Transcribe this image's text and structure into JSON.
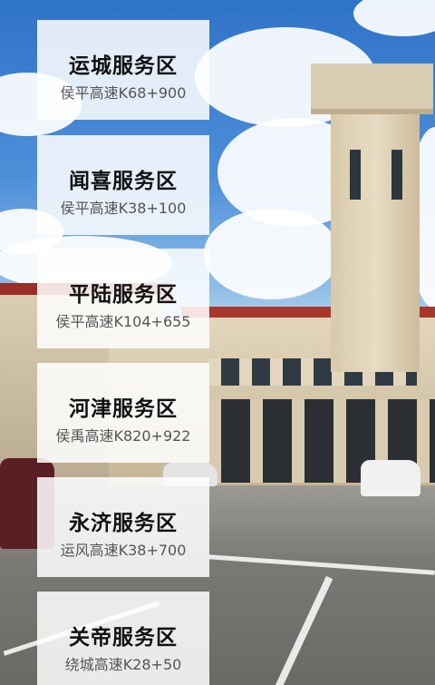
{
  "service_areas": [
    {
      "name": "运城服务区",
      "location": "侯平高速K68+900"
    },
    {
      "name": "闻喜服务区",
      "location": "侯平高速K38+100"
    },
    {
      "name": "平陆服务区",
      "location": "侯平高速K104+655"
    },
    {
      "name": "河津服务区",
      "location": "侯禹高速K820+922"
    },
    {
      "name": "永济服务区",
      "location": "运风高速K38+700"
    },
    {
      "name": "关帝服务区",
      "location": "绕城高速K28+50"
    }
  ],
  "background": {
    "subject": "service-station-building-with-clock-tower",
    "sky_color": "#2f73c8",
    "roof_color": "#a9382c"
  }
}
